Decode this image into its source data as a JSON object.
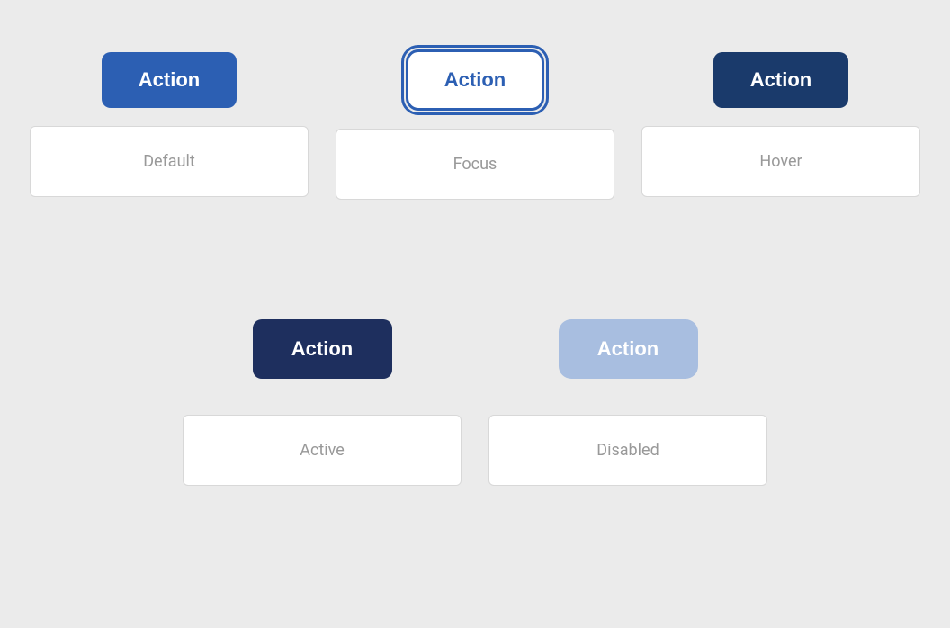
{
  "page": {
    "background_color": "#ebebeb"
  },
  "row1": {
    "default": {
      "button_label": "Action",
      "state_label": "Default"
    },
    "focus": {
      "button_label": "Action",
      "state_label": "Focus"
    },
    "hover": {
      "button_label": "Action",
      "state_label": "Hover"
    }
  },
  "row2": {
    "active": {
      "button_label": "Action",
      "state_label": "Active"
    },
    "disabled": {
      "button_label": "Action",
      "state_label": "Disabled"
    }
  }
}
